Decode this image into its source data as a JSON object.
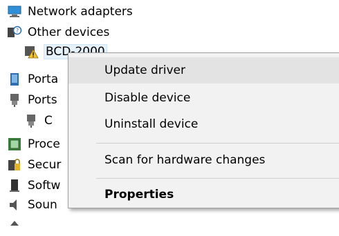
{
  "tree": {
    "items": [
      {
        "label": "Network adapters",
        "icon": "network-adapter-icon"
      },
      {
        "label": "Other devices",
        "icon": "other-devices-icon"
      },
      {
        "label": "BCD-2000",
        "icon": "unknown-device-warning-icon"
      },
      {
        "label": "Porta",
        "icon": "portable-devices-icon"
      },
      {
        "label": "Ports",
        "icon": "ports-icon"
      },
      {
        "label": "C",
        "icon": "com-port-icon"
      },
      {
        "label": "Proce",
        "icon": "processor-icon"
      },
      {
        "label": "Secur",
        "icon": "security-devices-icon"
      },
      {
        "label": "Softw",
        "icon": "software-devices-icon"
      },
      {
        "label": "Soun",
        "icon": "sound-icon"
      }
    ]
  },
  "context_menu": {
    "items": [
      {
        "label": "Update driver"
      },
      {
        "label": "Disable device"
      },
      {
        "label": "Uninstall device"
      },
      {
        "label": "Scan for hardware changes"
      },
      {
        "label": "Properties"
      }
    ]
  }
}
